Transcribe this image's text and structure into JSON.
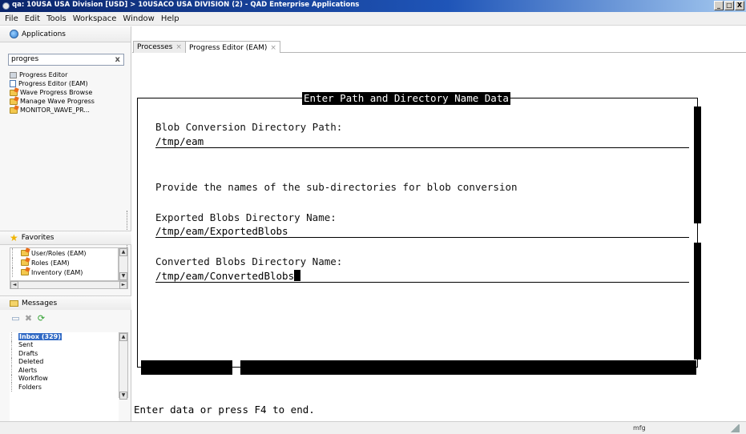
{
  "window": {
    "title": "qa: 10USA USA Division [USD] > 10USACO USA DIVISION (2) - QAD Enterprise Applications",
    "controls": [
      "_",
      "□",
      "X"
    ]
  },
  "menu": [
    "File",
    "Edit",
    "Tools",
    "Workspace",
    "Window",
    "Help"
  ],
  "sidebar": {
    "applications_label": "Applications",
    "search_value": "progres",
    "search_clear": "x",
    "app_items": [
      {
        "label": "Progress Editor",
        "icon": "program-icon"
      },
      {
        "label": "Progress Editor (EAM)",
        "icon": "list-icon"
      },
      {
        "label": "Wave Progress Browse",
        "icon": "folder-icon"
      },
      {
        "label": "Manage Wave Progress",
        "icon": "folder-icon"
      },
      {
        "label": "MONITOR_WAVE_PR...",
        "icon": "folder-icon"
      }
    ],
    "favorites_label": "Favorites",
    "favorite_items": [
      "User/Roles (EAM)",
      "Roles (EAM)",
      "Inventory (EAM)"
    ],
    "messages_label": "Messages",
    "message_folders": [
      "Inbox (329)",
      "Sent",
      "Drafts",
      "Deleted",
      "Alerts",
      "Workflow",
      "Folders"
    ]
  },
  "tabs": [
    {
      "label": "Processes",
      "close": "×",
      "active": false
    },
    {
      "label": "Progress Editor (EAM)",
      "close": "×",
      "active": true
    }
  ],
  "terminal": {
    "frame_title": "Enter Path and Directory Name Data",
    "blob_path_label": "Blob Conversion Directory Path:",
    "blob_path_value": "/tmp/eam",
    "instruction": "Provide the names of the sub-directories for blob conversion",
    "exported_label": "Exported Blobs Directory Name:",
    "exported_value": "/tmp/eam/ExportedBlobs",
    "converted_label": "Converted Blobs Directory Name:",
    "converted_value": "/tmp/eam/ConvertedBlobs",
    "status_message": "Enter data or press F4 to end."
  },
  "statusbar": {
    "user": "mfg"
  }
}
